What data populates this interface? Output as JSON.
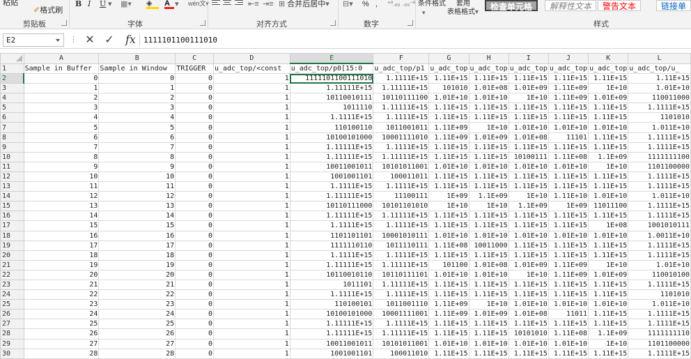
{
  "ribbon": {
    "paste": "粘贴",
    "format_painter": "格式刷",
    "bold": "B",
    "italic": "I",
    "underline": "U",
    "merge_center": "合并后居中",
    "percent": "%",
    "comma": ",",
    "conditional_format": "条件格式",
    "table_format_line1": "套用",
    "table_format_line2": "表格格式",
    "styles": [
      "检查单元格",
      "解释性文本",
      "警告文本",
      "链接单"
    ],
    "group_labels": [
      "剪贴板",
      "字体",
      "对齐方式",
      "数字",
      "样式"
    ],
    "colors": {
      "font_color": "#e0261a",
      "fill_color": "#ffd400"
    }
  },
  "formula_bar": {
    "name_box": "E2",
    "formula": "1111101100111010"
  },
  "grid": {
    "columns": [
      "",
      "A",
      "B",
      "C",
      "D",
      "E",
      "F",
      "G",
      "H",
      "I",
      "J",
      "K",
      "L"
    ],
    "selected_column": "E",
    "selected_row": "2",
    "header_row": [
      "Sample in Buffer",
      "Sample in Window",
      "TRIGGER",
      "u_adc_top/<const",
      "u_adc_top/p0[15:0",
      "u_adc_top/p1",
      "u_adc_top",
      "u_adc_top",
      "u_adc_top",
      "u_adc_top",
      "u_adc_top",
      "u_adc_top/u_"
    ],
    "rows": [
      [
        "2",
        "0",
        "0",
        "0",
        "1",
        "1111101100111010",
        "1.1111E+15",
        "1.11E+15",
        "1.11E+15",
        "1.11E+15",
        "1.11E+15",
        "1.11E+15",
        "1.11E+15"
      ],
      [
        "3",
        "1",
        "1",
        "0",
        "1",
        "1.11111E+15",
        "1.11111E+15",
        "101010",
        "1.01E+08",
        "1.01E+09",
        "1.11E+09",
        "1E+10",
        "1.01E+10"
      ],
      [
        "4",
        "2",
        "2",
        "0",
        "1",
        "10110010111",
        "10110111100",
        "1.01E+10",
        "1.01E+10",
        "1E+10",
        "1.11E+09",
        "1.01E+09",
        "110011000"
      ],
      [
        "5",
        "3",
        "3",
        "0",
        "1",
        "1011110",
        "1.11111E+15",
        "1.11E+15",
        "1.11E+15",
        "1.11E+15",
        "1.11E+15",
        "1.11E+15",
        "1.1111E+15"
      ],
      [
        "6",
        "4",
        "4",
        "0",
        "1",
        "1.1111E+15",
        "1.1111E+15",
        "1.11E+15",
        "1.11E+15",
        "1.11E+15",
        "1.11E+15",
        "1.11E+15",
        "1101010"
      ],
      [
        "7",
        "5",
        "5",
        "0",
        "1",
        "110100110",
        "1011001011",
        "1.11E+09",
        "1E+10",
        "1.01E+10",
        "1.01E+10",
        "1.01E+10",
        "1.011E+10"
      ],
      [
        "8",
        "6",
        "6",
        "0",
        "1",
        "10100101000",
        "10001111010",
        "1.11E+09",
        "1.01E+09",
        "1.01E+08",
        "11101",
        "1.11E+15",
        "1.1111E+15"
      ],
      [
        "9",
        "7",
        "7",
        "0",
        "1",
        "1.11111E+15",
        "1.1111E+15",
        "1.11E+15",
        "1.11E+15",
        "1.11E+15",
        "1.11E+15",
        "1.11E+15",
        "1.1111E+15"
      ],
      [
        "10",
        "8",
        "8",
        "0",
        "1",
        "1.11111E+15",
        "1.11111E+15",
        "1.11E+15",
        "1.11E+15",
        "10100111",
        "1.11E+08",
        "1.1E+09",
        "1111111100"
      ],
      [
        "11",
        "9",
        "9",
        "0",
        "1",
        "10011001011",
        "10101011001",
        "1.01E+10",
        "1.01E+10",
        "1.01E+10",
        "1.01E+10",
        "1E+10",
        "1101100000"
      ],
      [
        "12",
        "10",
        "10",
        "0",
        "1",
        "1001001101",
        "100011011",
        "1.11E+15",
        "1.11E+15",
        "1.11E+15",
        "1.11E+15",
        "1.11E+15",
        "1.1111E+15"
      ],
      [
        "13",
        "11",
        "11",
        "0",
        "1",
        "1.1111E+15",
        "1.1111E+15",
        "1.11E+15",
        "1.11E+15",
        "1.11E+15",
        "1.11E+15",
        "1.11E+15",
        "1.1111E+15"
      ],
      [
        "14",
        "12",
        "12",
        "0",
        "1",
        "1.11111E+15",
        "11100111",
        "1E+09",
        "1.1E+09",
        "1E+10",
        "1.11E+10",
        "1.01E+10",
        "1.011E+10"
      ],
      [
        "15",
        "13",
        "13",
        "0",
        "1",
        "10110111000",
        "10101101010",
        "1E+10",
        "1E+10",
        "1.1E+09",
        "1E+09",
        "11011100",
        "1.1111E+15"
      ],
      [
        "16",
        "14",
        "14",
        "0",
        "1",
        "1.11111E+15",
        "1.11111E+15",
        "1.11E+15",
        "1.11E+15",
        "1.11E+15",
        "1.11E+15",
        "1.11E+15",
        "1.1111E+15"
      ],
      [
        "17",
        "15",
        "15",
        "0",
        "1",
        "1.1111E+15",
        "1.1111E+15",
        "1.11E+15",
        "1.11E+15",
        "1.11E+15",
        "1.11E+15",
        "1E+08",
        "1001010111"
      ],
      [
        "18",
        "16",
        "16",
        "0",
        "1",
        "1101101101",
        "10001010111",
        "1.01E+10",
        "1.01E+10",
        "1.01E+10",
        "1.01E+10",
        "1.01E+10",
        "1.0011E+10"
      ],
      [
        "19",
        "17",
        "17",
        "0",
        "1",
        "1111110110",
        "1011110111",
        "1.11E+08",
        "10011000",
        "1.11E+15",
        "1.11E+15",
        "1.11E+15",
        "1.1111E+15"
      ],
      [
        "20",
        "18",
        "18",
        "0",
        "1",
        "1.1111E+15",
        "1.1111E+15",
        "1.11E+15",
        "1.11E+15",
        "1.11E+15",
        "1.11E+15",
        "1.11E+15",
        "1.1111E+15"
      ],
      [
        "21",
        "19",
        "19",
        "0",
        "1",
        "1.11111E+15",
        "1.11111E+15",
        "101100",
        "1.01E+08",
        "1.01E+09",
        "1.11E+09",
        "1E+10",
        "1.01E+10"
      ],
      [
        "22",
        "20",
        "20",
        "0",
        "1",
        "10110010110",
        "10110111101",
        "1.01E+10",
        "1.01E+10",
        "1E+10",
        "1.11E+09",
        "1.01E+09",
        "110010100"
      ],
      [
        "23",
        "21",
        "21",
        "0",
        "1",
        "1011101",
        "1.11111E+15",
        "1.11E+15",
        "1.11E+15",
        "1.11E+15",
        "1.11E+15",
        "1.11E+15",
        "1.1111E+15"
      ],
      [
        "24",
        "22",
        "22",
        "0",
        "1",
        "1.1111E+15",
        "1.1111E+15",
        "1.11E+15",
        "1.11E+15",
        "1.11E+15",
        "1.11E+15",
        "1.11E+15",
        "1101010"
      ],
      [
        "25",
        "23",
        "23",
        "0",
        "1",
        "110100101",
        "1011001110",
        "1.11E+09",
        "1E+10",
        "1.01E+10",
        "1.01E+10",
        "1.01E+10",
        "1.011E+10"
      ],
      [
        "26",
        "24",
        "24",
        "0",
        "1",
        "10100101000",
        "10001111001",
        "1.11E+09",
        "1.01E+09",
        "1.01E+08",
        "11011",
        "1.11E+15",
        "1.1111E+15"
      ],
      [
        "27",
        "25",
        "25",
        "0",
        "1",
        "1.11111E+15",
        "1.1111E+15",
        "1.11E+15",
        "1.11E+15",
        "1.11E+15",
        "1.11E+15",
        "1.11E+15",
        "1.1111E+15"
      ],
      [
        "28",
        "26",
        "26",
        "0",
        "1",
        "1.11111E+15",
        "1.11111E+15",
        "1.11E+15",
        "1.11E+15",
        "10101010",
        "1.11E+08",
        "1.1E+09",
        "1111111110"
      ],
      [
        "29",
        "27",
        "27",
        "0",
        "1",
        "10011001011",
        "10101011001",
        "1.01E+10",
        "1.01E+10",
        "1.01E+10",
        "1.01E+10",
        "1E+10",
        "1101100000"
      ],
      [
        "30",
        "28",
        "28",
        "0",
        "1",
        "1001001101",
        "100011010",
        "1.11E+15",
        "1.11E+15",
        "1.11E+15",
        "1.11E+15",
        "1.11E+15",
        "1.1111E+15"
      ]
    ]
  }
}
